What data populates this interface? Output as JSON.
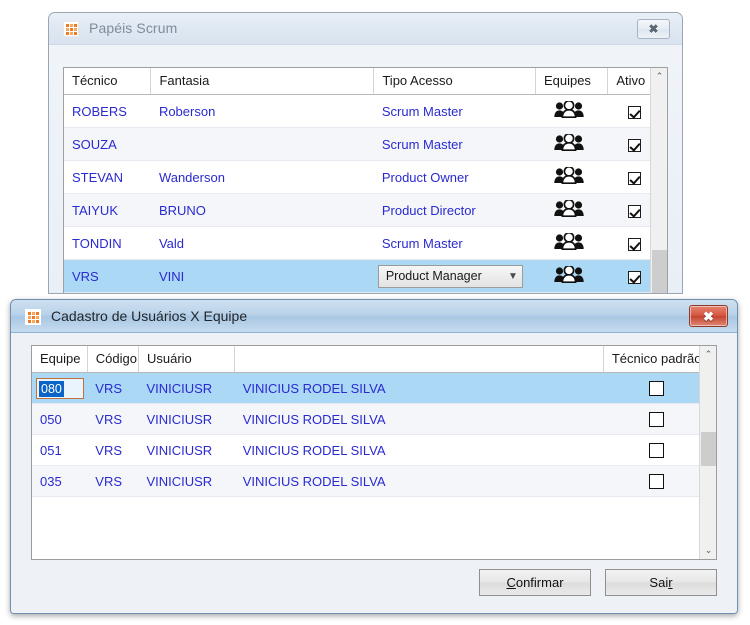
{
  "window1": {
    "title": "Papéis Scrum",
    "icon": "app-icon",
    "close_label": "✖",
    "grid": {
      "columns": [
        "Técnico",
        "Fantasia",
        "Tipo Acesso",
        "Equipes",
        "Ativo"
      ],
      "rows": [
        {
          "tecnico": "ROBERS",
          "fantasia": "Roberson",
          "tipo_acesso": "Scrum Master",
          "equipes_icon": "people-group-icon",
          "ativo": true,
          "selected": false,
          "editing": false
        },
        {
          "tecnico": "SOUZA",
          "fantasia": "",
          "tipo_acesso": "Scrum Master",
          "equipes_icon": "people-group-icon",
          "ativo": true,
          "selected": false,
          "editing": false
        },
        {
          "tecnico": "STEVAN",
          "fantasia": "Wanderson",
          "tipo_acesso": "Product Owner",
          "equipes_icon": "people-group-icon",
          "ativo": true,
          "selected": false,
          "editing": false
        },
        {
          "tecnico": "TAIYUK",
          "fantasia": "BRUNO",
          "tipo_acesso": "Product Director",
          "equipes_icon": "people-group-icon",
          "ativo": true,
          "selected": false,
          "editing": false
        },
        {
          "tecnico": "TONDIN",
          "fantasia": "Vald",
          "tipo_acesso": "Scrum Master",
          "equipes_icon": "people-group-icon",
          "ativo": true,
          "selected": false,
          "editing": false
        },
        {
          "tecnico": "VRS",
          "fantasia": "VINI",
          "tipo_acesso": "Product Manager",
          "equipes_icon": "people-group-icon",
          "ativo": true,
          "selected": true,
          "editing": true
        }
      ],
      "combo_value": "Product Manager",
      "scroll_up_icon": "⌃"
    }
  },
  "window2": {
    "title": "Cadastro de Usuários X  Equipe",
    "icon": "app-icon",
    "close_label": "✖",
    "grid": {
      "columns": [
        "Equipe",
        "Código",
        "Usuário",
        "",
        "Técnico padrão"
      ],
      "rows": [
        {
          "equipe": "080",
          "codigo": "VRS",
          "usuario": "VINICIUSR",
          "nome": "VINICIUS RODEL SILVA",
          "tecnico_padrao": false,
          "selected": true,
          "editing": true
        },
        {
          "equipe": "050",
          "codigo": "VRS",
          "usuario": "VINICIUSR",
          "nome": "VINICIUS RODEL SILVA",
          "tecnico_padrao": false,
          "selected": false,
          "editing": false
        },
        {
          "equipe": "051",
          "codigo": "VRS",
          "usuario": "VINICIUSR",
          "nome": "VINICIUS RODEL SILVA",
          "tecnico_padrao": false,
          "selected": false,
          "editing": false
        },
        {
          "equipe": "035",
          "codigo": "VRS",
          "usuario": "VINICIUSR",
          "nome": "VINICIUS RODEL SILVA",
          "tecnico_padrao": false,
          "selected": false,
          "editing": false
        }
      ],
      "scroll_up_icon": "⌃",
      "scroll_down_icon": "⌄"
    },
    "buttons": {
      "confirm": {
        "prefix": "",
        "accel": "C",
        "suffix": "onfirmar"
      },
      "exit": {
        "prefix": "Sai",
        "accel": "r",
        "suffix": ""
      }
    }
  },
  "colors": {
    "link_text": "#2a2ad0",
    "selection": "#abd8f5",
    "edit_border": "#c2703a",
    "close_active": "#d65a44"
  }
}
